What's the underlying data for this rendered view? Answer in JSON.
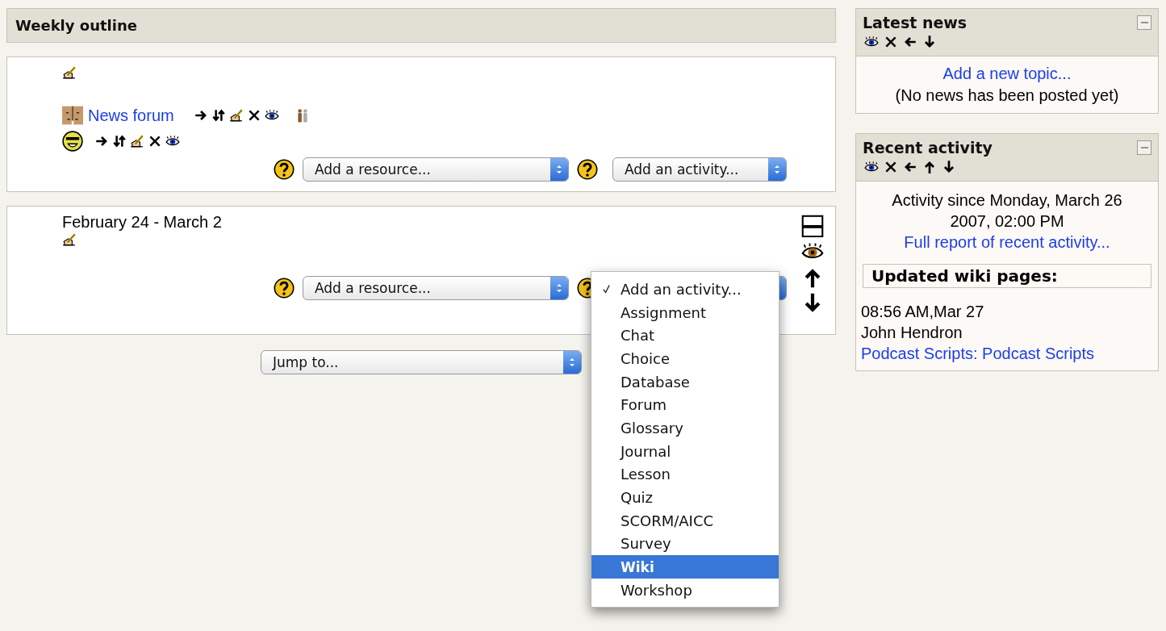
{
  "outline": {
    "title": "Weekly outline",
    "sections": [
      {
        "activities": [
          {
            "kind": "forum",
            "label": "News forum"
          },
          {
            "kind": "smiley"
          }
        ],
        "resource_select": {
          "value": "Add a resource..."
        },
        "activity_select": {
          "value": "Add an activity..."
        }
      },
      {
        "heading": "February 24 - March 2",
        "resource_select": {
          "value": "Add a resource..."
        }
      }
    ]
  },
  "jump_select": {
    "value": "Jump to..."
  },
  "activity_menu": {
    "items": [
      {
        "label": "Add an activity...",
        "checked": true,
        "selected": false
      },
      {
        "label": "Assignment",
        "checked": false,
        "selected": false
      },
      {
        "label": "Chat",
        "checked": false,
        "selected": false
      },
      {
        "label": "Choice",
        "checked": false,
        "selected": false
      },
      {
        "label": "Database",
        "checked": false,
        "selected": false
      },
      {
        "label": "Forum",
        "checked": false,
        "selected": false
      },
      {
        "label": "Glossary",
        "checked": false,
        "selected": false
      },
      {
        "label": "Journal",
        "checked": false,
        "selected": false
      },
      {
        "label": "Lesson",
        "checked": false,
        "selected": false
      },
      {
        "label": "Quiz",
        "checked": false,
        "selected": false
      },
      {
        "label": "SCORM/AICC",
        "checked": false,
        "selected": false
      },
      {
        "label": "Survey",
        "checked": false,
        "selected": false
      },
      {
        "label": "Wiki",
        "checked": false,
        "selected": true
      },
      {
        "label": "Workshop",
        "checked": false,
        "selected": false
      }
    ]
  },
  "blocks": [
    {
      "kind": "news",
      "title": "Latest news",
      "link": "Add a new topic...",
      "note": "(No news has been posted yet)"
    },
    {
      "kind": "recent",
      "title": "Recent activity",
      "since": "Activity since Monday, March 26 2007, 02:00 PM",
      "report_link": "Full report of recent activity...",
      "subheading": "Updated wiki pages:",
      "entries": [
        {
          "time": "08:56 AM,Mar 27",
          "author": "John Hendron",
          "link": "Podcast Scripts: Podcast Scripts"
        }
      ]
    }
  ]
}
